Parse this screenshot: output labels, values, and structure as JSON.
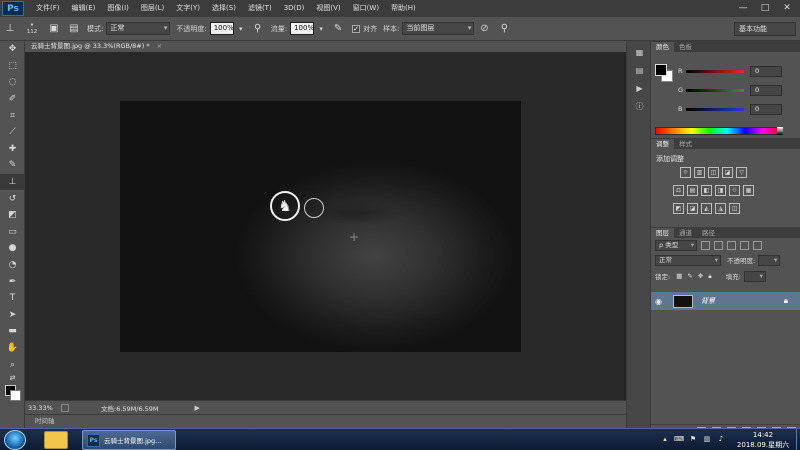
{
  "app": {
    "logo": "Ps",
    "menu": [
      "文件(F)",
      "编辑(E)",
      "图像(I)",
      "图层(L)",
      "文字(Y)",
      "选择(S)",
      "滤镜(T)",
      "3D(D)",
      "视图(V)",
      "窗口(W)",
      "帮助(H)"
    ],
    "window_controls": [
      "—",
      "□",
      "✕"
    ]
  },
  "options": {
    "brush_size": "112",
    "mode_label": "模式:",
    "mode_value": "正常",
    "opacity_label": "不透明度:",
    "opacity_value": "100%",
    "flow_label": "流量:",
    "flow_value": "100%",
    "aligned_label": "对齐",
    "sample_label": "样本:",
    "sample_value": "当前图层",
    "workspace": "基本功能"
  },
  "document": {
    "tab_title": "云骑士背景图.jpg @ 33.3%(RGB/8#) *",
    "tab_close": "×",
    "zoom": "33.33%",
    "doc_info": "文档:6.59M/6.59M",
    "timeline_tab": "时间轴"
  },
  "tools": [
    "move-icon",
    "marquee-icon",
    "lasso-icon",
    "quick-select-icon",
    "crop-icon",
    "eyedropper-icon",
    "healing-icon",
    "brush-icon",
    "clone-stamp-icon",
    "history-brush-icon",
    "eraser-icon",
    "gradient-icon",
    "blur-icon",
    "dodge-icon",
    "pen-icon",
    "type-icon",
    "path-select-icon",
    "rectangle-icon",
    "hand-icon",
    "zoom-icon"
  ],
  "color_panel": {
    "tabs": [
      "颜色",
      "色板"
    ],
    "channels": [
      {
        "label": "R",
        "value": "0",
        "color": "#d23232"
      },
      {
        "label": "G",
        "value": "0",
        "color": "#2a9a2a"
      },
      {
        "label": "B",
        "value": "0",
        "color": "#2a3ad2"
      }
    ]
  },
  "adjust_panel": {
    "tabs": [
      "调整",
      "样式"
    ],
    "title": "添加调整",
    "row1": [
      "☼",
      "▥",
      "◫",
      "◪",
      "▽"
    ],
    "row2": [
      "⚖",
      "▤",
      "◧",
      "◨",
      "♲",
      "▦"
    ],
    "row3": [
      "◩",
      "◪",
      "◭",
      "◮",
      "◫"
    ]
  },
  "layers_panel": {
    "tabs": [
      "图层",
      "通道",
      "路径"
    ],
    "kind_filter": "ρ 类型",
    "blend_mode": "正常",
    "opacity_label": "不透明度:",
    "lock_label": "锁定:",
    "fill_label": "填充:",
    "layer_name": "背景"
  },
  "taskbar": {
    "ps_task_label": "云骑士背景图.jpg...",
    "ps_task_icon": "Ps",
    "time": "14:42",
    "date": "2018.09.星期六"
  }
}
